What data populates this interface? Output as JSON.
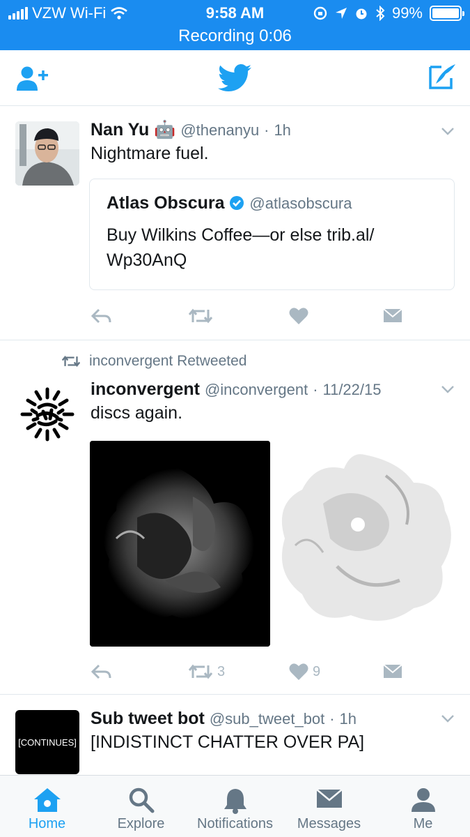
{
  "status_bar": {
    "carrier": "VZW Wi-Fi",
    "time": "9:58 AM",
    "battery": "99%",
    "battery_level": 0.99,
    "recording": "Recording  0:06"
  },
  "nav": {
    "left_icon": "add-user-icon",
    "center_icon": "twitter-bird-icon",
    "right_icon": "compose-icon"
  },
  "tweets": [
    {
      "name": "Nan Yu",
      "emoji": "🤖",
      "handle": "@thenanyu",
      "sep": "·",
      "time": "1h",
      "text": "Nightmare fuel.",
      "quote": {
        "name": "Atlas Obscura",
        "handle": "@atlasobscura",
        "text": "Buy Wilkins Coffee—or else trib.al/ Wp30AnQ"
      }
    },
    {
      "retweeted_by": "inconvergent Retweeted",
      "name": "inconvergent",
      "handle": "@inconvergent",
      "sep": "·",
      "time": "11/22/15",
      "text": "discs again.",
      "retweets": "3",
      "likes": "9"
    },
    {
      "name": "Sub tweet bot",
      "handle": "@sub_tweet_bot",
      "sep": "·",
      "time": "1h",
      "text": "[INDISTINCT CHATTER OVER PA]",
      "avatar_text": "[CONTINUES]"
    }
  ],
  "tabs": [
    {
      "label": "Home",
      "icon": "home-icon",
      "active": true
    },
    {
      "label": "Explore",
      "icon": "search-icon",
      "active": false
    },
    {
      "label": "Notifications",
      "icon": "bell-icon",
      "active": false
    },
    {
      "label": "Messages",
      "icon": "envelope-icon",
      "active": false
    },
    {
      "label": "Me",
      "icon": "person-icon",
      "active": false
    }
  ],
  "colors": {
    "brand": "#1da1f2",
    "status_bar": "#1a8cf0",
    "muted": "#657786",
    "action": "#aab8c2"
  }
}
